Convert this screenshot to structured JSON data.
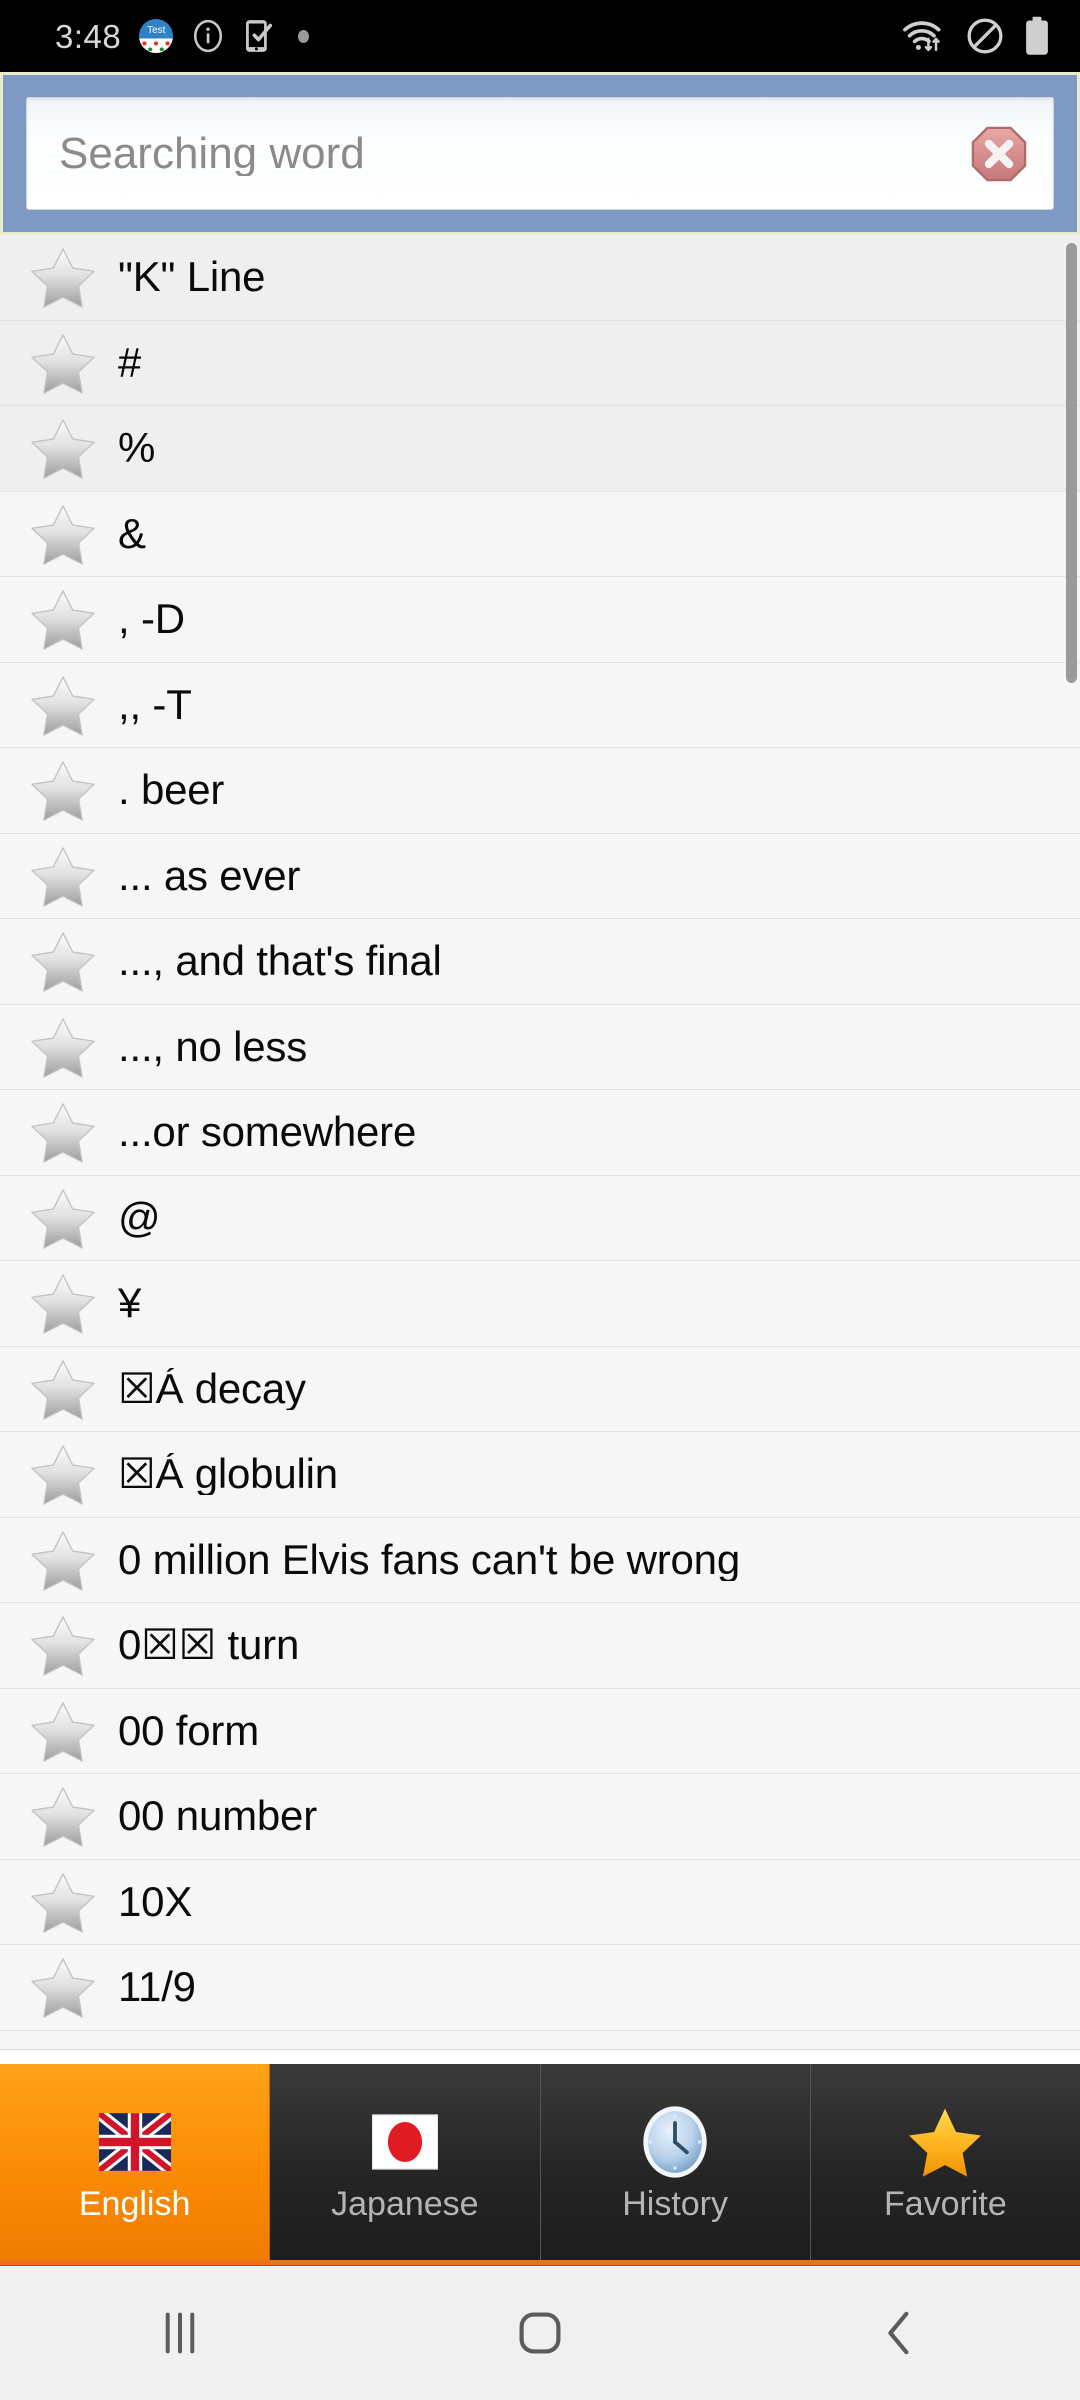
{
  "status_bar": {
    "time": "3:48",
    "app_badge_text": "Test",
    "icons_left": [
      "app-test-icon",
      "info-circle-icon",
      "phone-check-icon",
      "notification-dot-icon"
    ],
    "icons_right": [
      "wifi-transfer-icon",
      "do-not-disturb-icon",
      "battery-icon"
    ]
  },
  "search": {
    "placeholder": "Searching word",
    "value": "",
    "clear_icon": "octagon-close-icon",
    "panel_color": "#7e9ac4",
    "border_color": "#e9eccc"
  },
  "list": {
    "star_icon": "star-outline-icon",
    "items": [
      {
        "label": "\"K\" Line"
      },
      {
        "label": "#"
      },
      {
        "label": "%"
      },
      {
        "label": "&"
      },
      {
        "label": ", -D"
      },
      {
        "label": ",, -T"
      },
      {
        "label": ". beer"
      },
      {
        "label": "... as ever"
      },
      {
        "label": "..., and that's final"
      },
      {
        "label": "..., no less"
      },
      {
        "label": "...or somewhere"
      },
      {
        "label": "@"
      },
      {
        "label": "¥"
      },
      {
        "label": "☒Á decay"
      },
      {
        "label": "☒Á globulin"
      },
      {
        "label": "0 million Elvis fans can't be wrong"
      },
      {
        "label": "0☒☒ turn"
      },
      {
        "label": "00 form"
      },
      {
        "label": "00 number"
      },
      {
        "label": "10X"
      },
      {
        "label": "11/9"
      }
    ]
  },
  "tabs": {
    "active_index": 0,
    "accent_color": "#f07c00",
    "items": [
      {
        "label": "English",
        "icon": "uk-flag-icon"
      },
      {
        "label": "Japanese",
        "icon": "japan-flag-icon"
      },
      {
        "label": "History",
        "icon": "clock-icon"
      },
      {
        "label": "Favorite",
        "icon": "gold-star-icon"
      }
    ]
  },
  "nav_bar": {
    "items": [
      {
        "icon": "recents-icon"
      },
      {
        "icon": "home-icon"
      },
      {
        "icon": "back-icon"
      }
    ]
  }
}
